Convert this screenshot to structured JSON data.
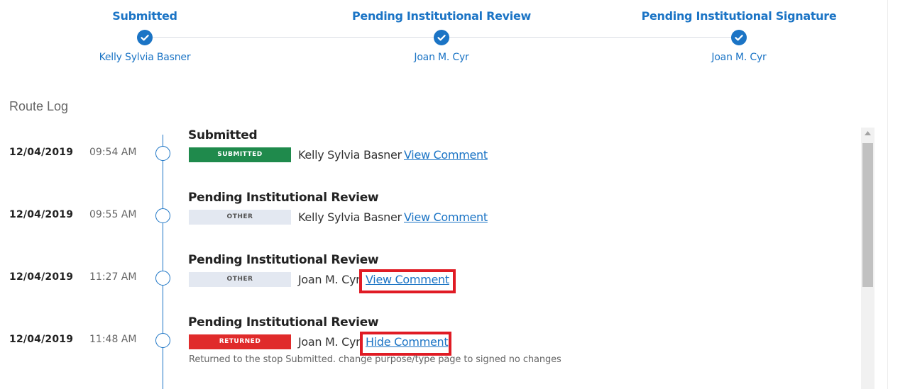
{
  "stepper": {
    "steps": [
      {
        "title": "Submitted",
        "person": "Kelly Sylvia Basner",
        "status_icon": "check-circle-icon"
      },
      {
        "title": "Pending Institutional Review",
        "person": "Joan M. Cyr",
        "status_icon": "check-circle-icon"
      },
      {
        "title": "Pending Institutional Signature",
        "person": "Joan M. Cyr",
        "status_icon": "check-circle-icon"
      }
    ]
  },
  "route_log": {
    "title": "Route Log",
    "entries": [
      {
        "title": "Submitted",
        "date": "12/04/2019",
        "time": "09:54 AM",
        "badge": "SUBMITTED",
        "person": "Kelly Sylvia Basner",
        "link": "View Comment"
      },
      {
        "title": "Pending Institutional Review",
        "date": "12/04/2019",
        "time": "09:55 AM",
        "badge": "OTHER",
        "person": "Kelly Sylvia Basner",
        "link": "View Comment"
      },
      {
        "title": "Pending Institutional Review",
        "date": "12/04/2019",
        "time": "11:27 AM",
        "badge": "OTHER",
        "person": "Joan M. Cyr",
        "link": "View Comment"
      },
      {
        "title": "Pending Institutional Review",
        "date": "12/04/2019",
        "time": "11:48 AM",
        "badge": "RETURNED",
        "person": "Joan M. Cyr",
        "link": "Hide Comment",
        "comment": "Returned to the stop Submitted. change purpose/type page to signed no changes"
      }
    ]
  },
  "colors": {
    "accent": "#1b74c5",
    "badge_submitted": "#1f8a4c",
    "badge_other": "#e3e8f1",
    "badge_returned": "#e02b2b",
    "highlight": "#e01b24"
  }
}
